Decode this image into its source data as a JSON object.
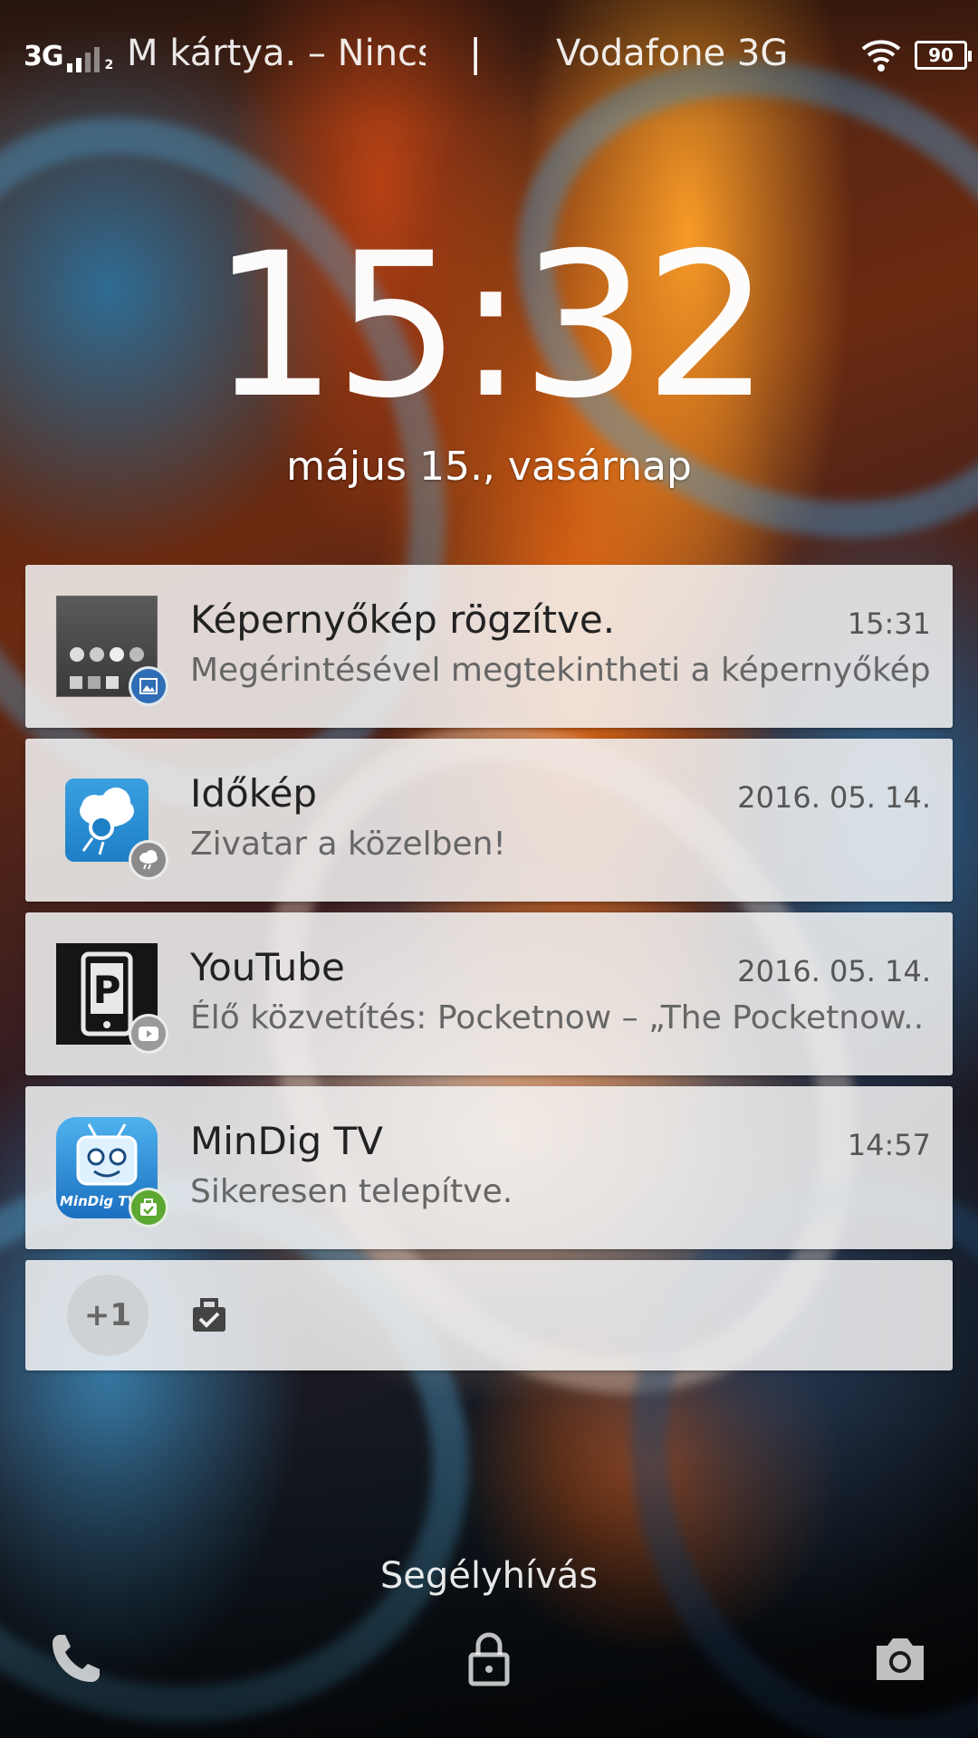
{
  "status_bar": {
    "network_type": "3G",
    "sim_slot": "2",
    "carrier_left": "M kártya. – Nincs",
    "separator": "|",
    "carrier_right": "Vodafone 3G",
    "battery_level": "90",
    "icons": [
      "signal-icon",
      "wifi-icon",
      "battery-icon"
    ]
  },
  "lockscreen": {
    "time": "15:32",
    "date": "május 15., vasárnap"
  },
  "notifications": [
    {
      "title": "Képernyőkép rögzítve.",
      "time": "15:31",
      "text": "Megérintésével megtekintheti a képernyőkép..",
      "icon": "screenshot-thumbnail",
      "badge_icon": "image-icon",
      "badge_color": "#2f6db5"
    },
    {
      "title": "Időkép",
      "time": "2016. 05. 14.",
      "text": "Zivatar a közelben! ",
      "icon": "idokep-app-icon",
      "badge_icon": "storm-cloud-icon",
      "badge_color": "#8a8a8a"
    },
    {
      "title": "YouTube",
      "time": "2016. 05. 14.",
      "text": "Élő közvetítés: Pocketnow – „The Pocketnow..",
      "icon": "pocketnow-icon",
      "badge_icon": "play-icon",
      "badge_color": "#9a9a9a"
    },
    {
      "title": "MinDig TV",
      "time": "14:57",
      "text": "Sikeresen telepítve.",
      "icon": "mindig-tv-app-icon",
      "icon_label": "MinDig TV",
      "badge_icon": "bag-check-icon",
      "badge_color": "#5ca832"
    }
  ],
  "overflow": {
    "count_label": "+1",
    "icon": "bag-check-icon"
  },
  "bottom": {
    "emergency_label": "Segélyhívás",
    "left_icon": "phone-icon",
    "center_icon": "lock-icon",
    "right_icon": "camera-icon"
  }
}
